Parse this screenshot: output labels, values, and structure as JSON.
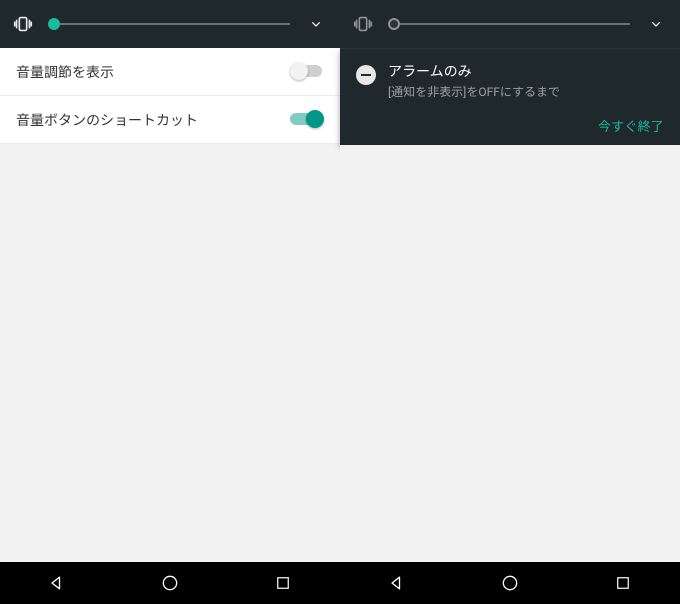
{
  "left": {
    "settings": [
      {
        "label": "音量調節を表示",
        "on": false
      },
      {
        "label": "音量ボタンのショートカット",
        "on": true
      }
    ]
  },
  "right": {
    "notification": {
      "title": "アラームのみ",
      "subtitle": "[通知を非表示]をOFFにするまで",
      "action": "今すぐ終了"
    }
  },
  "colors": {
    "accent": "#1abc9c"
  }
}
